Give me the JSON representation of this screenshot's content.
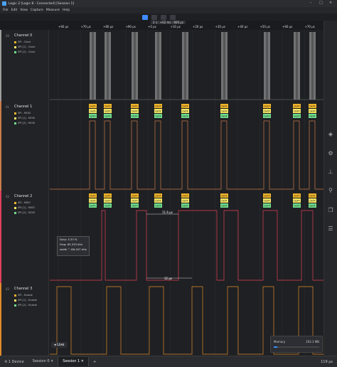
{
  "window": {
    "title": "Logic 2 [Logic 8 - Connected] [Session 1]",
    "min": "–",
    "max": "□",
    "close": "✕"
  },
  "menu": {
    "items": [
      "File",
      "Edit",
      "View",
      "Capture",
      "Measure",
      "Help"
    ]
  },
  "timeline": {
    "zoom_label": "2 s : +62 ms : 800 μs",
    "ticks": [
      "+60 μs",
      "+70 μs",
      "+80 μs",
      "+90 μs",
      "+0 μs",
      "+10 μs",
      "+20 μs",
      "+30 μs",
      "+40 μs",
      "+50 μs",
      "+60 μs",
      "+70 μs"
    ]
  },
  "channels": [
    {
      "num": "00",
      "name": "Channel 0",
      "color": "#9e9e9e",
      "subs": [
        [
          "SPI - Clock",
          "#f0b429"
        ],
        [
          "SPI [1] - Clock",
          "#f5e663"
        ],
        [
          "SPI [2] - Clock",
          "#6fdc8c"
        ]
      ]
    },
    {
      "num": "01",
      "name": "Channel 1",
      "color": "#c97b4a",
      "subs": [
        [
          "SPI - MOSI",
          "#f0b429"
        ],
        [
          "SPI [1] - MOSI",
          "#f5e663"
        ],
        [
          "SPI [2] - MOSI",
          "#6fdc8c"
        ]
      ]
    },
    {
      "num": "02",
      "name": "Channel 2",
      "color": "#e0405a",
      "subs": [
        [
          "SPI - MISO",
          "#f0b429"
        ],
        [
          "SPI [1] - MISO",
          "#f5e663"
        ],
        [
          "SPI [2] - MOSI",
          "#6fdc8c"
        ]
      ]
    },
    {
      "num": "03",
      "name": "Channel 3",
      "color": "#e08a2a",
      "subs": [
        [
          "SPI - Enable",
          "#f0b429"
        ],
        [
          "SPI [1] - Enable",
          "#f5e663"
        ],
        [
          "SPI [2] - Enable",
          "#6fdc8c"
        ]
      ]
    }
  ],
  "measurement": {
    "width_top": "11.6 μs",
    "width_bottom": "12 μs",
    "duty": "Duty: 3.33 %",
    "freq": "Freq: 83.333 kHz",
    "width": "width ⁺: 86.207 kHz"
  },
  "decoder_label": "0xFF",
  "memory": {
    "label": "Memory",
    "value": "103.1 MB",
    "fraction": 0.08
  },
  "live_button": "Live",
  "status": {
    "device": "1 Device",
    "tabs": [
      "Session 0",
      "Session 1"
    ],
    "active_tab": 1,
    "add_tab": "+",
    "zoom": "119 μs"
  },
  "colors": {
    "accent": "#3d8cff",
    "ch0": "#9e9e9e",
    "ch1": "#c97b4a",
    "ch2": "#e0405a",
    "ch3": "#e08a2a"
  }
}
